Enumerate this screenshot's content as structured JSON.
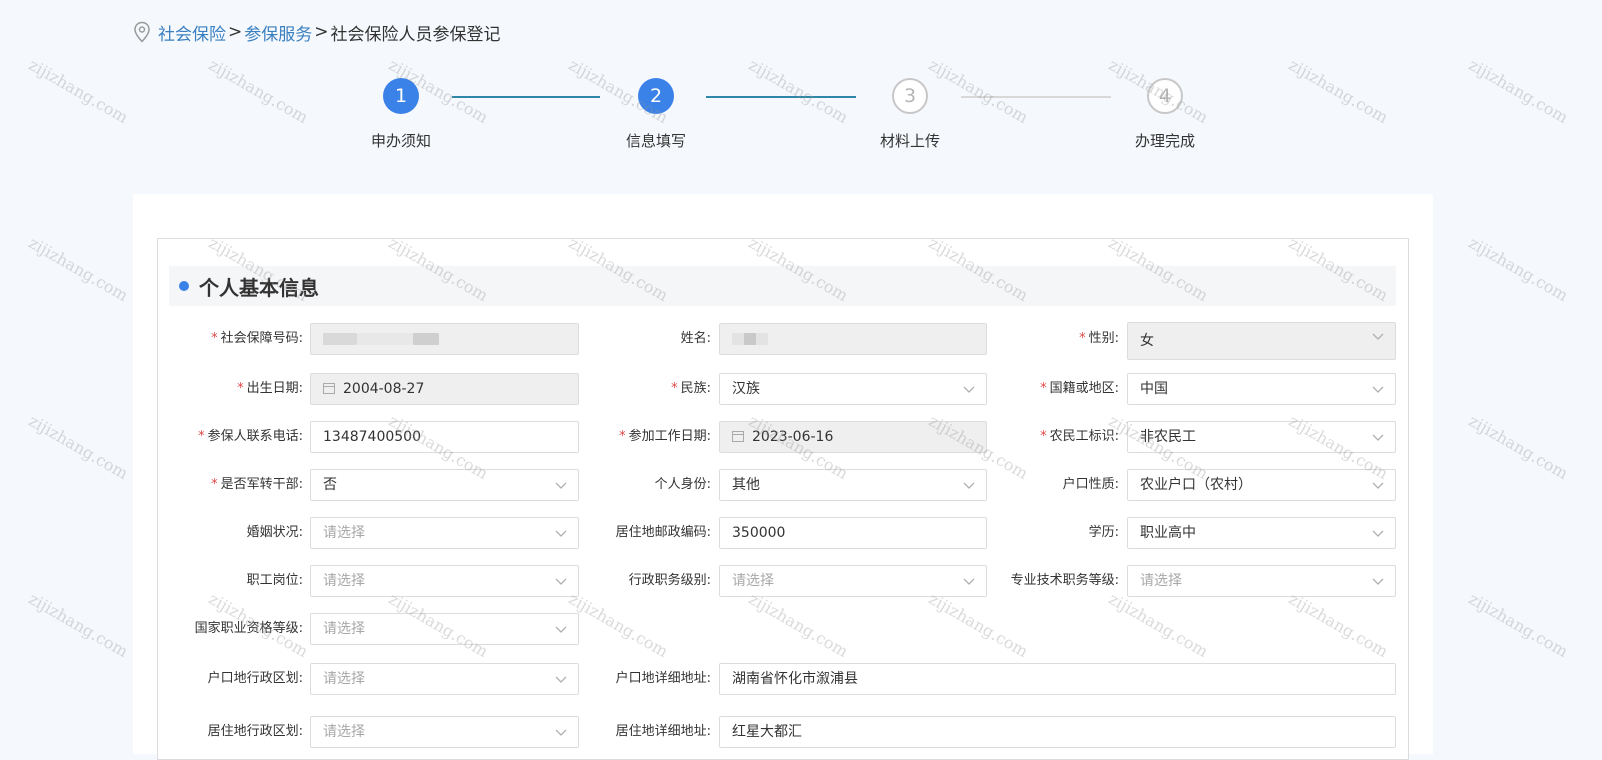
{
  "breadcrumb": {
    "items": [
      "社会保险",
      "参保服务"
    ],
    "separator": ">",
    "current": "社会保险人员参保登记"
  },
  "steps": [
    {
      "num": "1",
      "label": "申办须知",
      "state": "active"
    },
    {
      "num": "2",
      "label": "信息填写",
      "state": "active"
    },
    {
      "num": "3",
      "label": "材料上传",
      "state": "inactive"
    },
    {
      "num": "4",
      "label": "办理完成",
      "state": "inactive"
    }
  ],
  "section": {
    "title": "个人基本信息"
  },
  "fields": {
    "ssn": {
      "label": "社会保障号码:",
      "required": true,
      "value": "",
      "disabled": true
    },
    "name": {
      "label": "姓名:",
      "required": false,
      "value": "",
      "disabled": true
    },
    "gender": {
      "label": "性别:",
      "required": true,
      "value": "女",
      "disabled": true
    },
    "birth": {
      "label": "出生日期:",
      "required": true,
      "value": "2004-08-27",
      "disabled": true
    },
    "ethnicity": {
      "label": "民族:",
      "required": true,
      "value": "汉族"
    },
    "nationality": {
      "label": "国籍或地区:",
      "required": true,
      "value": "中国"
    },
    "phone": {
      "label": "参保人联系电话:",
      "required": true,
      "value": "13487400500"
    },
    "work_date": {
      "label": "参加工作日期:",
      "required": true,
      "value": "2023-06-16",
      "disabled": true
    },
    "migrant": {
      "label": "农民工标识:",
      "required": true,
      "value": "非农民工"
    },
    "military": {
      "label": "是否军转干部:",
      "required": true,
      "value": "否"
    },
    "identity": {
      "label": "个人身份:",
      "required": false,
      "value": "其他"
    },
    "hukou_type": {
      "label": "户口性质:",
      "required": false,
      "value": "农业户口（农村）"
    },
    "marital": {
      "label": "婚姻状况:",
      "required": false,
      "placeholder": "请选择"
    },
    "postcode": {
      "label": "居住地邮政编码:",
      "required": false,
      "value": "350000"
    },
    "education": {
      "label": "学历:",
      "required": false,
      "value": "职业高中"
    },
    "position": {
      "label": "职工岗位:",
      "required": false,
      "placeholder": "请选择"
    },
    "admin_level": {
      "label": "行政职务级别:",
      "required": false,
      "placeholder": "请选择"
    },
    "tech_level": {
      "label": "专业技术职务等级:",
      "required": false,
      "placeholder": "请选择"
    },
    "qualification": {
      "label": "国家职业资格等级:",
      "required": false,
      "placeholder": "请选择"
    },
    "hukou_region": {
      "label": "户口地行政区划:",
      "required": false,
      "placeholder": "请选择"
    },
    "hukou_address": {
      "label": "户口地详细地址:",
      "required": false,
      "value": "湖南省怀化市溆浦县"
    },
    "res_region": {
      "label": "居住地行政区划:",
      "required": false,
      "placeholder": "请选择"
    },
    "res_address": {
      "label": "居住地详细地址:",
      "required": false,
      "value": "红星大都汇"
    }
  },
  "watermark": "zijizhang.com",
  "colors": {
    "accent": "#3b82e8",
    "link": "#3a7fc0",
    "required": "#e04545",
    "line_done": "#2e86a8"
  }
}
